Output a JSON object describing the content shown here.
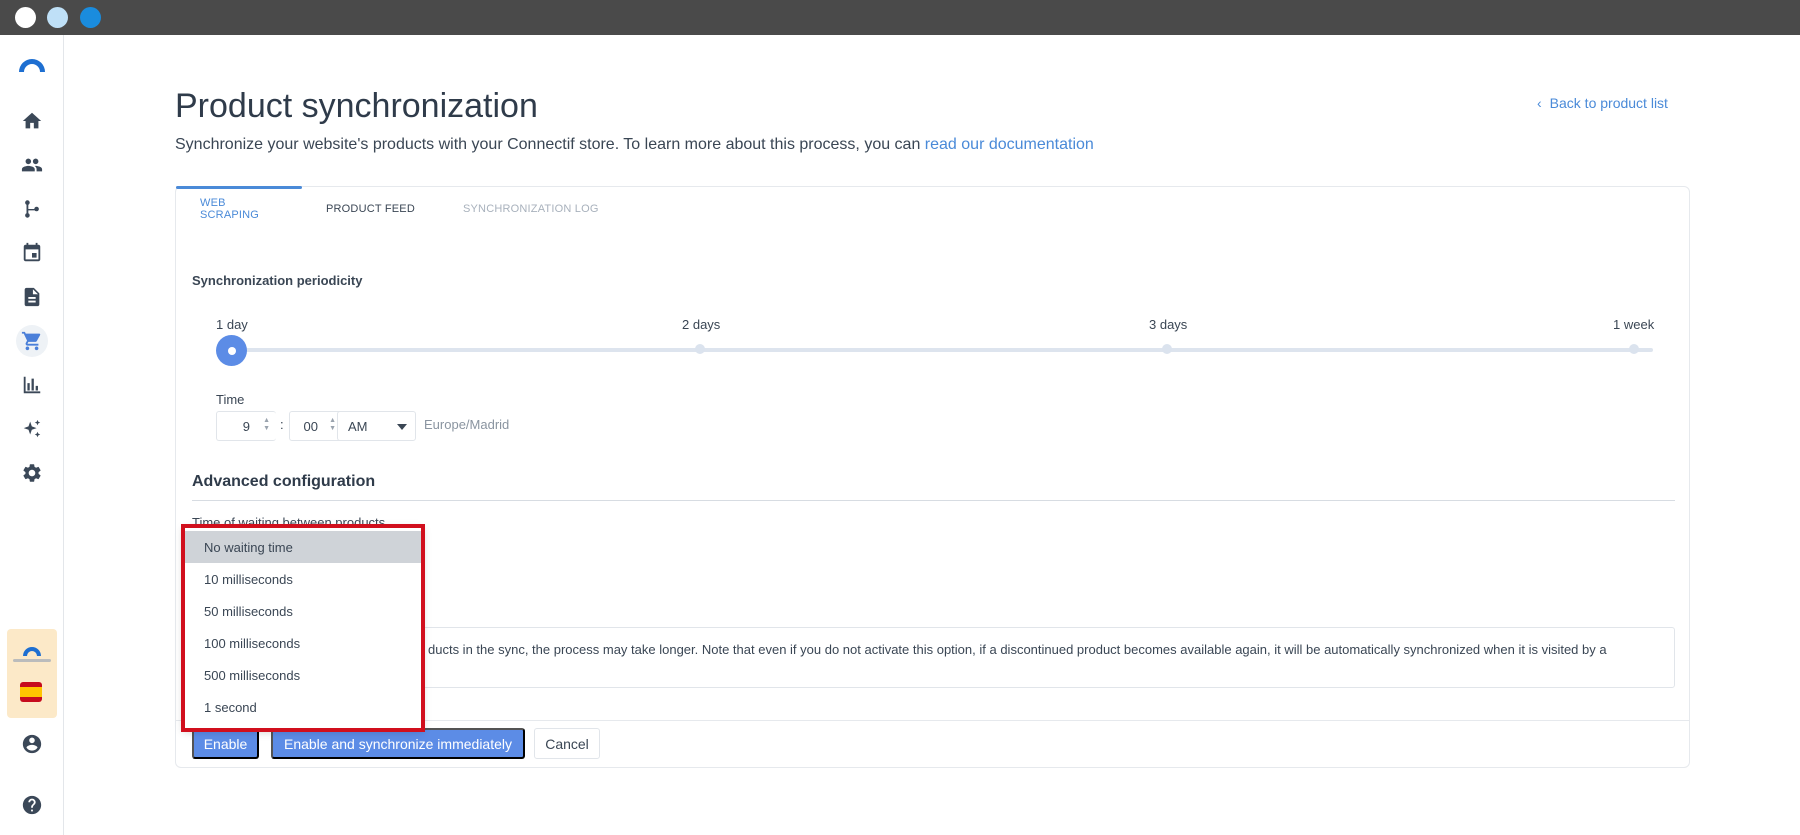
{
  "window": {
    "title_bar_dots": [
      "close",
      "minimize",
      "maximize"
    ]
  },
  "sidebar": {
    "items": [
      {
        "name": "home",
        "icon": "home-icon"
      },
      {
        "name": "contacts",
        "icon": "users-icon"
      },
      {
        "name": "workflows",
        "icon": "workflow-icon"
      },
      {
        "name": "calendar",
        "icon": "calendar-icon"
      },
      {
        "name": "content",
        "icon": "document-icon"
      },
      {
        "name": "store",
        "icon": "cart-icon",
        "active": true
      },
      {
        "name": "reports",
        "icon": "bar-chart-icon"
      },
      {
        "name": "ai",
        "icon": "sparkles-icon"
      },
      {
        "name": "settings",
        "icon": "gear-icon"
      }
    ],
    "bottom": [
      "account-icon",
      "help-icon"
    ]
  },
  "header": {
    "title": "Product synchronization",
    "subtitle_text": "Synchronize your website's products with your Connectif store. To learn more about this process, you can ",
    "subtitle_link": "read our documentation",
    "back_link": "Back to product list"
  },
  "tabs": [
    {
      "label": "WEB SCRAPING",
      "state": "active"
    },
    {
      "label": "PRODUCT FEED",
      "state": "normal"
    },
    {
      "label": "SYNCHRONIZATION LOG",
      "state": "disabled"
    }
  ],
  "periodicity": {
    "label": "Synchronization periodicity",
    "options": [
      "1 day",
      "2 days",
      "3 days",
      "1 week"
    ],
    "selected": "1 day"
  },
  "time": {
    "label": "Time",
    "hour": "9",
    "separator": ":",
    "minutes": "00",
    "ampm": "AM",
    "timezone": "Europe/Madrid"
  },
  "advanced": {
    "title": "Advanced configuration",
    "waiting_label": "Time of waiting between products",
    "info_text": "ducts in the sync, the process may take longer. Note that even if you do not activate this option, if a discontinued product becomes available again, it will be automatically synchronized when it is visited by a"
  },
  "dropdown": {
    "options": [
      "No waiting time",
      "10 milliseconds",
      "50 milliseconds",
      "100 milliseconds",
      "500 milliseconds",
      "1 second"
    ],
    "highlighted": "No waiting time"
  },
  "buttons": {
    "enable": "Enable",
    "enable_sync": "Enable and synchronize immediately",
    "cancel": "Cancel"
  },
  "colors": {
    "accent": "#5c8ce6",
    "link": "#4a8ad8",
    "highlight_border": "#d10f1d",
    "titlebar": "#4a4a4a"
  }
}
